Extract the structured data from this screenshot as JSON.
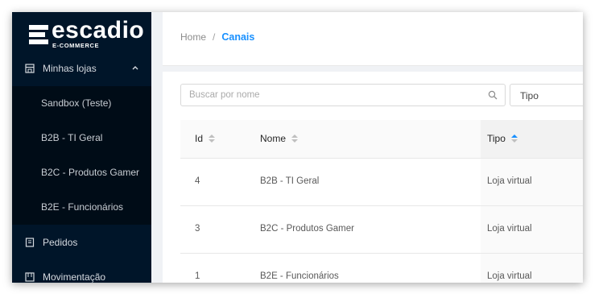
{
  "logo": {
    "word": "escadio",
    "sub": "E-COMMERCE"
  },
  "sidebar": {
    "group": {
      "label": "Minhas lojas",
      "icon": "store-icon"
    },
    "subitems": [
      {
        "label": "Sandbox (Teste)"
      },
      {
        "label": "B2B - TI Geral"
      },
      {
        "label": "B2C - Produtos Gamer"
      },
      {
        "label": "B2E - Funcionários"
      }
    ],
    "items": [
      {
        "label": "Pedidos",
        "icon": "orders-icon"
      },
      {
        "label": "Movimentação",
        "icon": "movement-icon"
      }
    ]
  },
  "breadcrumb": {
    "home": "Home",
    "separator": "/",
    "current": "Canais"
  },
  "filters": {
    "search_placeholder": "Buscar por nome",
    "type_placeholder": "Tipo"
  },
  "table": {
    "headers": {
      "id": "Id",
      "nome": "Nome",
      "tipo": "Tipo"
    },
    "sorted_column": "tipo",
    "rows": [
      {
        "id": "4",
        "nome": "B2B - TI Geral",
        "tipo": "Loja virtual"
      },
      {
        "id": "3",
        "nome": "B2C - Produtos Gamer",
        "tipo": "Loja virtual"
      },
      {
        "id": "1",
        "nome": "B2E - Funcionários",
        "tipo": "Loja virtual"
      }
    ]
  },
  "colors": {
    "sidebar_bg": "#001529",
    "submenu_bg": "#000c17",
    "accent": "#1890ff"
  }
}
